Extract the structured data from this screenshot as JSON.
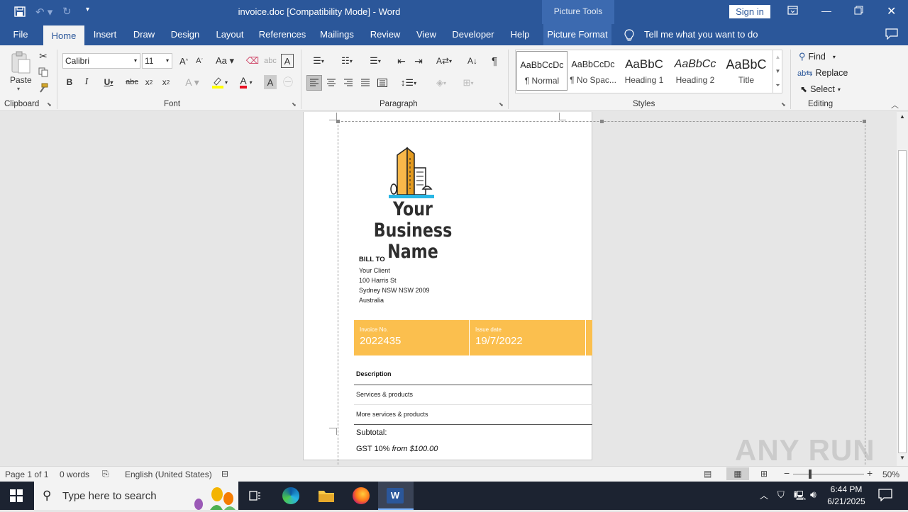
{
  "titlebar": {
    "document_title": "invoice.doc [Compatibility Mode]  -  Word",
    "context_tool": "Picture Tools",
    "sign_in": "Sign in"
  },
  "tabs": [
    "File",
    "Home",
    "Insert",
    "Draw",
    "Design",
    "Layout",
    "References",
    "Mailings",
    "Review",
    "View",
    "Developer",
    "Help",
    "Picture Format"
  ],
  "tell_me": "Tell me what you want to do",
  "ribbon": {
    "clipboard": {
      "paste": "Paste",
      "label": "Clipboard"
    },
    "font": {
      "name": "Calibri",
      "size": "11",
      "label": "Font"
    },
    "paragraph": {
      "label": "Paragraph"
    },
    "styles": {
      "label": "Styles",
      "items": [
        {
          "preview": "AaBbCcDc",
          "name": "¶ Normal"
        },
        {
          "preview": "AaBbCcDc",
          "name": "¶ No Spac..."
        },
        {
          "preview": "AaBbC",
          "name": "Heading 1"
        },
        {
          "preview": "AaBbCc",
          "name": "Heading 2"
        },
        {
          "preview": "AaBbC",
          "name": "Title"
        }
      ]
    },
    "editing": {
      "find": "Find",
      "replace": "Replace",
      "select": "Select",
      "label": "Editing"
    }
  },
  "document": {
    "business_name_line1": "Your Business",
    "business_name_line2": "Name",
    "bill_to_heading": "BILL TO",
    "bill_to_lines": [
      "Your Client",
      "100 Harris St",
      "Sydney NSW NSW 2009",
      "Australia"
    ],
    "invoice_no_label": "Invoice No.",
    "invoice_no_value": "2022435",
    "issue_date_label": "Issue date",
    "issue_date_value": "19/7/2022",
    "description_header": "Description",
    "rows": [
      "Services & products",
      "More services & products"
    ],
    "subtotal_label": "Subtotal:",
    "gst_label": "GST 10%",
    "gst_from": "from $100.00"
  },
  "status": {
    "page": "Page 1 of 1",
    "words": "0 words",
    "language": "English (United States)",
    "zoom": "50%"
  },
  "taskbar": {
    "search_placeholder": "Type here to search",
    "time": "6:44 PM",
    "date": "6/21/2025"
  },
  "watermark": "ANY RUN",
  "colors": {
    "word_blue": "#2b579a",
    "invoice_accent": "#fbbf4e"
  }
}
